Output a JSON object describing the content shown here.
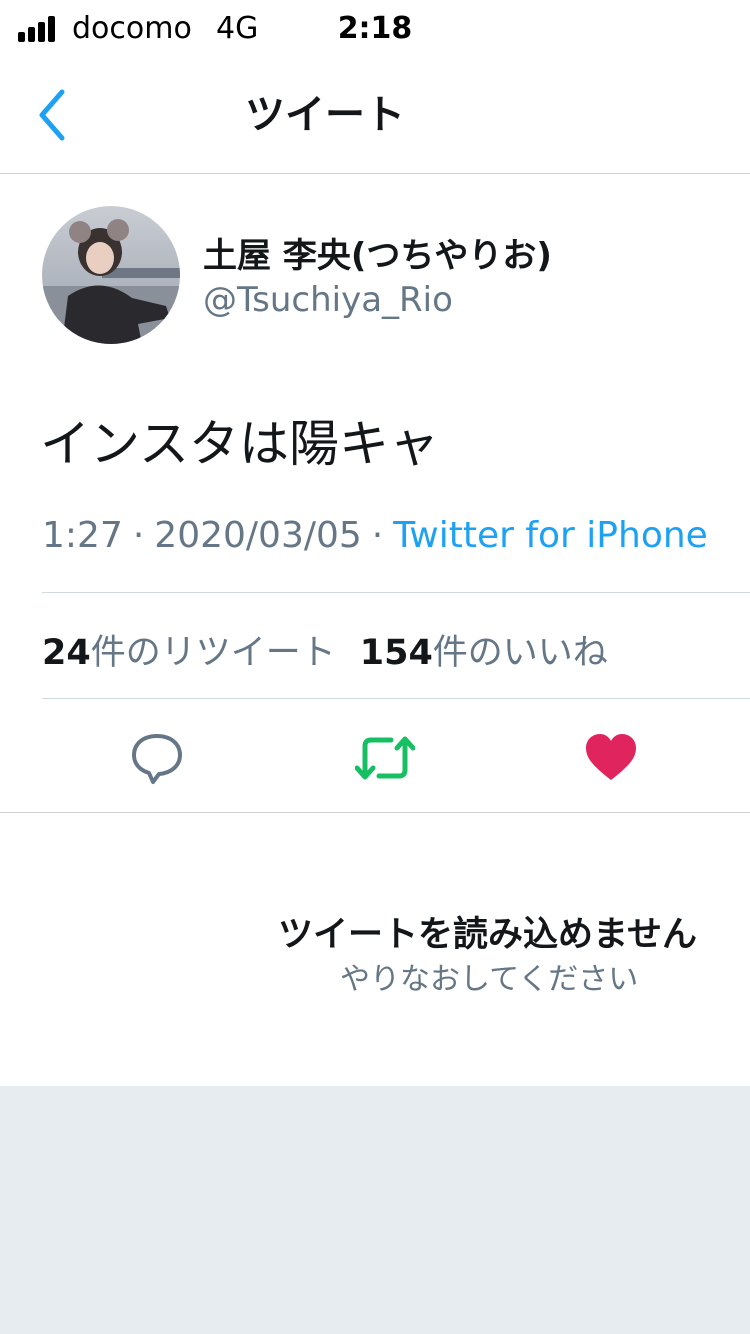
{
  "status_bar": {
    "carrier": "docomo",
    "network": "4G",
    "time": "2:18"
  },
  "nav": {
    "title": "ツイート",
    "back_icon": "chevron-left-icon",
    "accent": "#1da1f2"
  },
  "tweet": {
    "author_name": "土屋 李央(つちやりお)",
    "author_handle": "@Tsuchiya_Rio",
    "text": "インスタは陽キャ",
    "time": "1:27",
    "separator": "·",
    "date": "2020/03/05",
    "source": "Twitter for iPhone",
    "retweet_count": "24",
    "retweet_label": "件のリツイート",
    "like_count": "154",
    "like_label": "件のいいね"
  },
  "actions": {
    "reply_icon": "reply-bubble-icon",
    "retweet_icon": "retweet-icon",
    "like_icon": "heart-icon",
    "retweet_color": "#17bf63",
    "like_color": "#e0245e"
  },
  "error": {
    "title": "ツイートを読み込めません",
    "subtitle": "やりなおしてください"
  }
}
